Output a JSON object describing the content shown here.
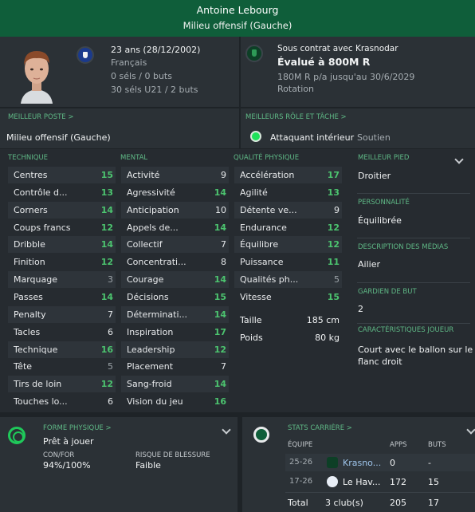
{
  "header": {
    "name": "Antoine Lebourg",
    "position": "Milieu offensif (Gauche)"
  },
  "profile": {
    "age": "23 ans (28/12/2002)",
    "nationality": "Français",
    "caps": "0 séls / 0 buts",
    "youth_caps": "30 séls U21 / 2 buts"
  },
  "contract": {
    "status": "Sous contrat avec Krasnodar",
    "value": "Évalué à 800M R",
    "wage": "180M R p/a jusqu'au 30/6/2029",
    "role": "Rotation"
  },
  "best_position": {
    "header": "MEILLEUR POSTE >",
    "value": "Milieu offensif (Gauche)"
  },
  "best_role": {
    "header": "MEILLEURS RÔLE ET TÂCHE >",
    "role": "Attaquant intérieur",
    "duty": "Soutien"
  },
  "technique": {
    "header": "TECHNIQUE",
    "rows": [
      {
        "label": "Centres",
        "value": "15"
      },
      {
        "label": "Contrôle d...",
        "value": "13"
      },
      {
        "label": "Corners",
        "value": "14"
      },
      {
        "label": "Coups francs",
        "value": "12"
      },
      {
        "label": "Dribble",
        "value": "14"
      },
      {
        "label": "Finition",
        "value": "12"
      },
      {
        "label": "Marquage",
        "value": "3"
      },
      {
        "label": "Passes",
        "value": "14"
      },
      {
        "label": "Penalty",
        "value": "7"
      },
      {
        "label": "Tacles",
        "value": "6"
      },
      {
        "label": "Technique",
        "value": "16"
      },
      {
        "label": "Tête",
        "value": "5"
      },
      {
        "label": "Tirs de loin",
        "value": "12"
      },
      {
        "label": "Touches lo...",
        "value": "6"
      }
    ]
  },
  "mental": {
    "header": "MENTAL",
    "rows": [
      {
        "label": "Activité",
        "value": "9"
      },
      {
        "label": "Agressivité",
        "value": "14"
      },
      {
        "label": "Anticipation",
        "value": "10"
      },
      {
        "label": "Appels de...",
        "value": "14"
      },
      {
        "label": "Collectif",
        "value": "7"
      },
      {
        "label": "Concentrati...",
        "value": "8"
      },
      {
        "label": "Courage",
        "value": "14"
      },
      {
        "label": "Décisions",
        "value": "15"
      },
      {
        "label": "Déterminati...",
        "value": "14"
      },
      {
        "label": "Inspiration",
        "value": "17"
      },
      {
        "label": "Leadership",
        "value": "12"
      },
      {
        "label": "Placement",
        "value": "7"
      },
      {
        "label": "Sang-froid",
        "value": "14"
      },
      {
        "label": "Vision du jeu",
        "value": "16"
      }
    ]
  },
  "physical": {
    "header": "QUALITÉ PHYSIQUE",
    "rows": [
      {
        "label": "Accélération",
        "value": "17"
      },
      {
        "label": "Agilité",
        "value": "13"
      },
      {
        "label": "Détente ve...",
        "value": "9"
      },
      {
        "label": "Endurance",
        "value": "12"
      },
      {
        "label": "Équilibre",
        "value": "12"
      },
      {
        "label": "Puissance",
        "value": "11"
      },
      {
        "label": "Qualités ph...",
        "value": "5"
      },
      {
        "label": "Vitesse",
        "value": "15"
      }
    ],
    "height_label": "Taille",
    "height": "185 cm",
    "weight_label": "Poids",
    "weight": "80 kg"
  },
  "side": {
    "foot_header": "MEILLEUR PIED",
    "foot": "Droitier",
    "personality_header": "PERSONNALITÉ",
    "personality": "Équilibrée",
    "media_header": "DESCRIPTION DES MÉDIAS",
    "media": "Ailier",
    "keeper_header": "GARDIEN DE BUT",
    "keeper": "2",
    "traits_header": "CARACTÉRISTIQUES JOUEUR",
    "traits_line1": "Court avec le ballon sur le",
    "traits_line2": "flanc droit"
  },
  "fitness": {
    "header": "FORME PHYSIQUE >",
    "status": "Prêt à jouer",
    "condition_label": "CON/FOR",
    "condition": "94%/100%",
    "injury_label": "RISQUE DE BLESSURE",
    "injury": "Faible"
  },
  "career": {
    "header": "STATS CARRIÈRE >",
    "columns": {
      "team": "ÉQUIPE",
      "apps": "APPS",
      "goals": "BUTS"
    },
    "rows": [
      {
        "season": "25-26",
        "club": "Krasno...",
        "apps": "0",
        "goals": "-"
      },
      {
        "season": "17-26",
        "club": "Le Hav...",
        "apps": "172",
        "goals": "15"
      }
    ],
    "total": {
      "label": "Total",
      "clubs": "3 club(s)",
      "apps": "205",
      "goals": "17"
    }
  },
  "colors": {
    "header_bg": "#0f5e3a",
    "high": "#4cc46f",
    "accent": "#1ee15a"
  }
}
